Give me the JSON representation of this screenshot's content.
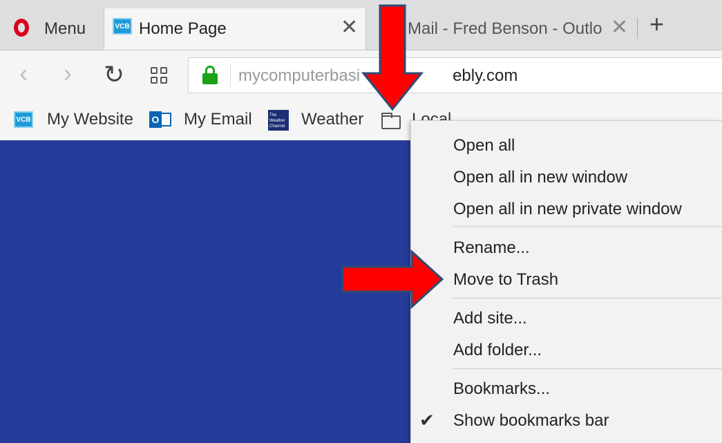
{
  "tabs": {
    "menu_label": "Menu",
    "active": {
      "icon_text": "VCB",
      "title": "Home Page",
      "close": "✕"
    },
    "inactive": {
      "title": "Mail - Fred Benson - Outlo",
      "close": "✕"
    },
    "new_tab": "+"
  },
  "toolbar": {
    "back": "‹",
    "forward": "›",
    "reload": "↻",
    "url_prefix": "mycomputerbasi",
    "url_domain": "ebly.com"
  },
  "bookmarks": [
    {
      "icon": "vcb-icon",
      "icon_text": "VCB",
      "label": "My Website"
    },
    {
      "icon": "outlook-icon",
      "icon_text": "O",
      "label": "My Email"
    },
    {
      "icon": "weather-channel-icon",
      "icon_text": "The Weather Channel",
      "label": "Weather"
    },
    {
      "icon": "folder-icon",
      "label": "Local"
    }
  ],
  "context_menu": {
    "items": [
      "Open all",
      "Open all in new window",
      "Open all in new private window",
      "Rename...",
      "Move to Trash",
      "Add site...",
      "Add folder...",
      "Bookmarks...",
      "Show bookmarks bar"
    ],
    "show_bookmarks_bar_checked": true
  },
  "colors": {
    "page_background": "#253b9a",
    "annotation_arrow": "#ff0000",
    "lock_green": "#1aa31a",
    "opera_red": "#d9001b"
  }
}
